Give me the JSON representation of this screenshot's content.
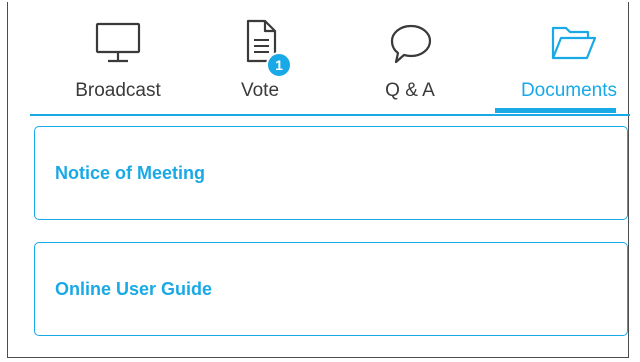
{
  "tabs": [
    {
      "label": "Broadcast",
      "icon": "monitor-icon",
      "active": false
    },
    {
      "label": "Vote",
      "icon": "document-icon",
      "active": false,
      "badge": "1"
    },
    {
      "label": "Q & A",
      "icon": "speech-bubble-icon",
      "active": false
    },
    {
      "label": "Documents",
      "icon": "folder-open-icon",
      "active": true
    }
  ],
  "documents": [
    {
      "title": "Notice of Meeting"
    },
    {
      "title": "Online User Guide"
    }
  ],
  "colors": {
    "accent": "#19a9e6",
    "text": "#3a3a3a",
    "border": "#4d4d4d"
  }
}
